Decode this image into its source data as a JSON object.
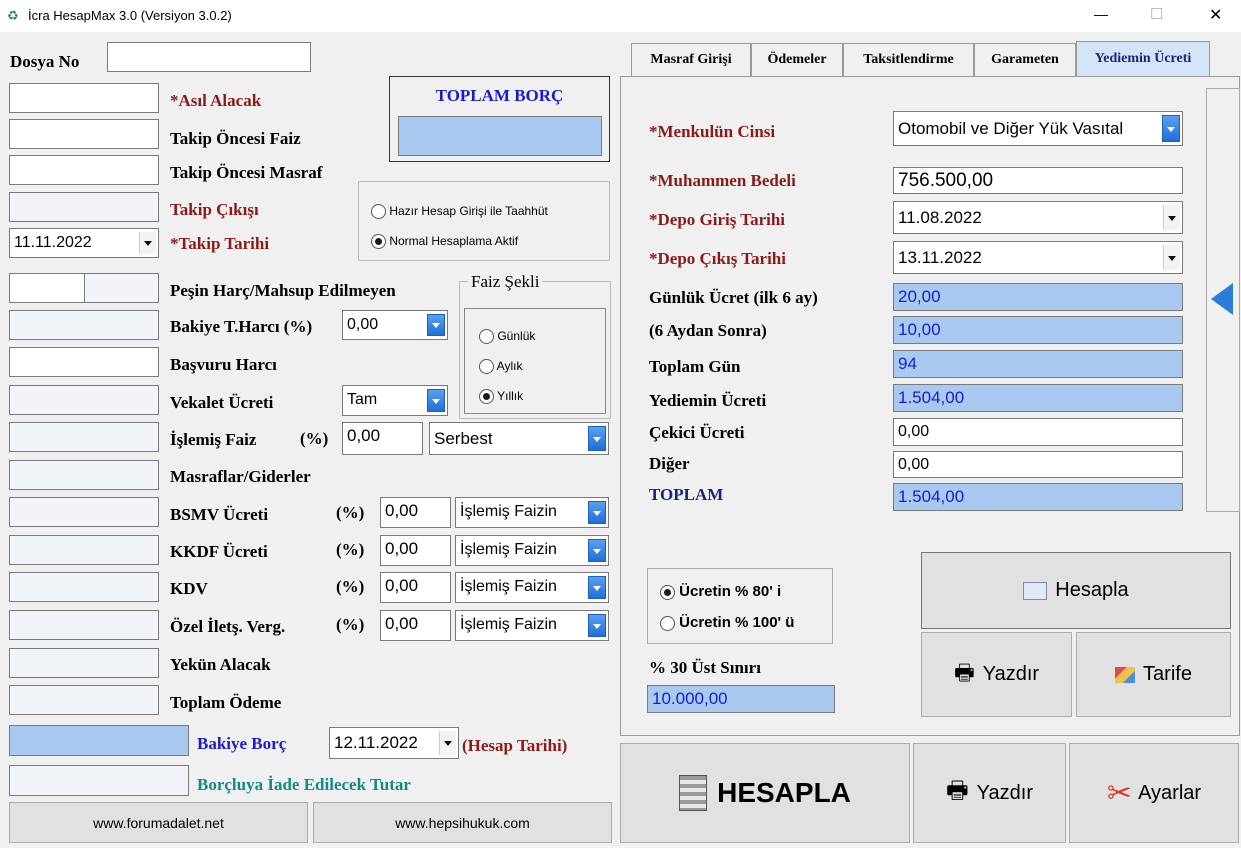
{
  "window": {
    "title": "İcra HesapMax 3.0 (Versiyon 3.0.2)",
    "min": "—",
    "max": "☐",
    "close": "✕"
  },
  "left": {
    "dosya_no": "Dosya No",
    "asil_alacak": "*Asıl Alacak",
    "takip_oncesi_faiz": "Takip Öncesi Faiz",
    "takip_oncesi_masraf": "Takip Öncesi Masraf",
    "takip_cikisi": "Takip Çıkışı",
    "takip_tarihi_value": "11.11.2022",
    "takip_tarihi": "*Takip Tarihi",
    "pesin_harc": "Peşin Harç/Mahsup Edilmeyen",
    "bakiye_harci": "Bakiye T.Harcı (%)",
    "bakiye_harci_value": "0,00",
    "basvuru_harci": "Başvuru Harcı",
    "vekalet_ucreti": "Vekalet Ücreti",
    "vekalet_value": "Tam",
    "islemis_faiz": "İşlemiş Faiz",
    "islemis_pct": "(%)",
    "islemis_value": "0,00",
    "islemis_type": "Serbest",
    "masraflar": "Masraflar/Giderler",
    "bsmv": "BSMV Ücreti",
    "kkdf": "KKDF Ücreti",
    "kdv": "KDV",
    "ozel": "Özel İletş. Verg.",
    "pct": "(%)",
    "tax_value": "0,00",
    "tax_type": "İşlemiş Faizin",
    "yekun": "Yekün Alacak",
    "toplam_odeme": "Toplam Ödeme",
    "bakiye_borc": "Bakiye Borç",
    "hesap_tarihi_value": "12.11.2022",
    "hesap_tarihi": "(Hesap Tarihi)",
    "iade": "Borçluya İade Edilecek Tutar",
    "link1": "www.forumadalet.net",
    "link2": "www.hepsihukuk.com"
  },
  "toplam_borc": {
    "title": "TOPLAM BORÇ"
  },
  "mode": {
    "opt1": "Hazır Hesap Girişi ile Taahhüt",
    "opt2": "Normal Hesaplama Aktif"
  },
  "faiz_sekli": {
    "title": "Faiz Şekli",
    "gunluk": "Günlük",
    "aylik": "Aylık",
    "yillik": "Yıllık"
  },
  "tabs": [
    "Masraf Girişi",
    "Ödemeler",
    "Taksitlendirme",
    "Garameten",
    "Yediemin Ücreti"
  ],
  "yediemin": {
    "menkul_cinsi": "*Menkulün Cinsi",
    "menkul_value": "Otomobil ve Diğer Yük Vasıtal",
    "muhammen": "*Muhammen Bedeli",
    "muhammen_value": "756.500,00",
    "giris": "*Depo Giriş Tarihi",
    "giris_value": "11.08.2022",
    "cikis": "*Depo Çıkış Tarihi",
    "cikis_value": "13.11.2022",
    "gunluk_ucret": "Günlük Ücret (ilk 6 ay)",
    "gunluk_value": "20,00",
    "alti_aydan": "(6 Aydan Sonra)",
    "alti_value": "10,00",
    "toplam_gun": "Toplam Gün",
    "toplam_gun_value": "94",
    "yediemin_ucreti": "Yediemin Ücreti",
    "yediemin_value": "1.504,00",
    "cekici": "Çekici Ücreti",
    "cekici_value": "0,00",
    "diger": "Diğer",
    "diger_value": "0,00",
    "toplam": "TOPLAM",
    "toplam_value": "1.504,00",
    "r80": "Ücretin % 80' i",
    "r100": "Ücretin % 100' ü",
    "ust_siniri": "% 30 Üst Sınırı",
    "ust_value": "10.000,00",
    "hesapla": "Hesapla",
    "yazdir": "Yazdır",
    "tarife": "Tarife"
  },
  "bottom": {
    "hesapla": "HESAPLA",
    "yazdir": "Yazdır",
    "ayarlar": "Ayarlar"
  }
}
